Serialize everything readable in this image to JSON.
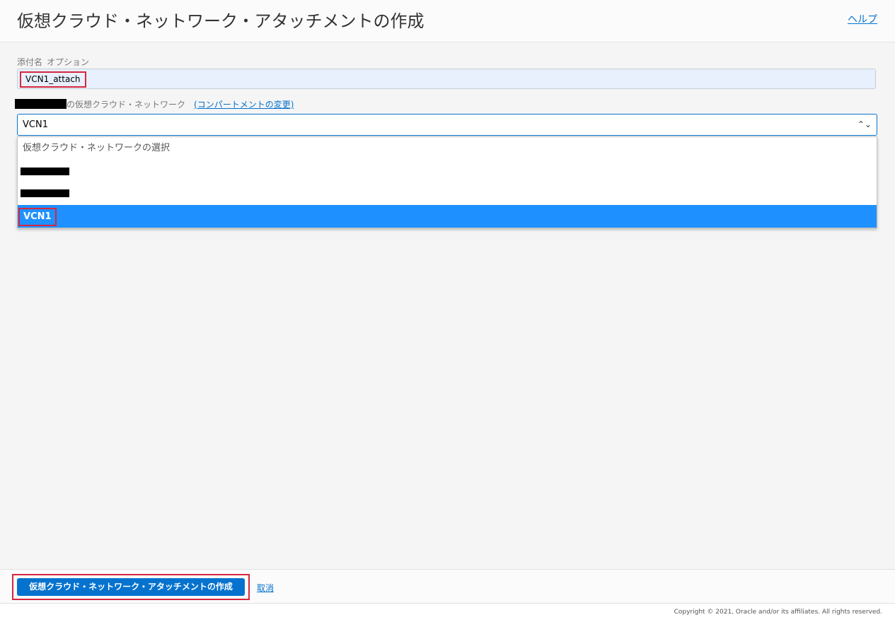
{
  "header": {
    "title": "仮想クラウド・ネットワーク・アタッチメントの作成",
    "help_link": "ヘルプ"
  },
  "form": {
    "name_field": {
      "label": "添付名",
      "optional": "オプション",
      "value": "VCN1_attach"
    },
    "vcn_field": {
      "label_suffix": "の仮想クラウド・ネットワーク",
      "change_compartment_link": "(コンパートメントの変更)",
      "selected_value": "VCN1",
      "options": [
        "仮想クラウド・ネットワークの選択",
        "VCN1"
      ]
    }
  },
  "footer": {
    "create_button": "仮想クラウド・ネットワーク・アタッチメントの作成",
    "cancel_link": "取消",
    "copyright": "Copyright © 2021, Oracle and/or its affiliates. All rights reserved."
  },
  "colors": {
    "accent_blue": "#0572ce",
    "selected_option": "#1e90ff",
    "highlight_red": "#d7263d",
    "autofill_background": "#e8f0fe"
  }
}
